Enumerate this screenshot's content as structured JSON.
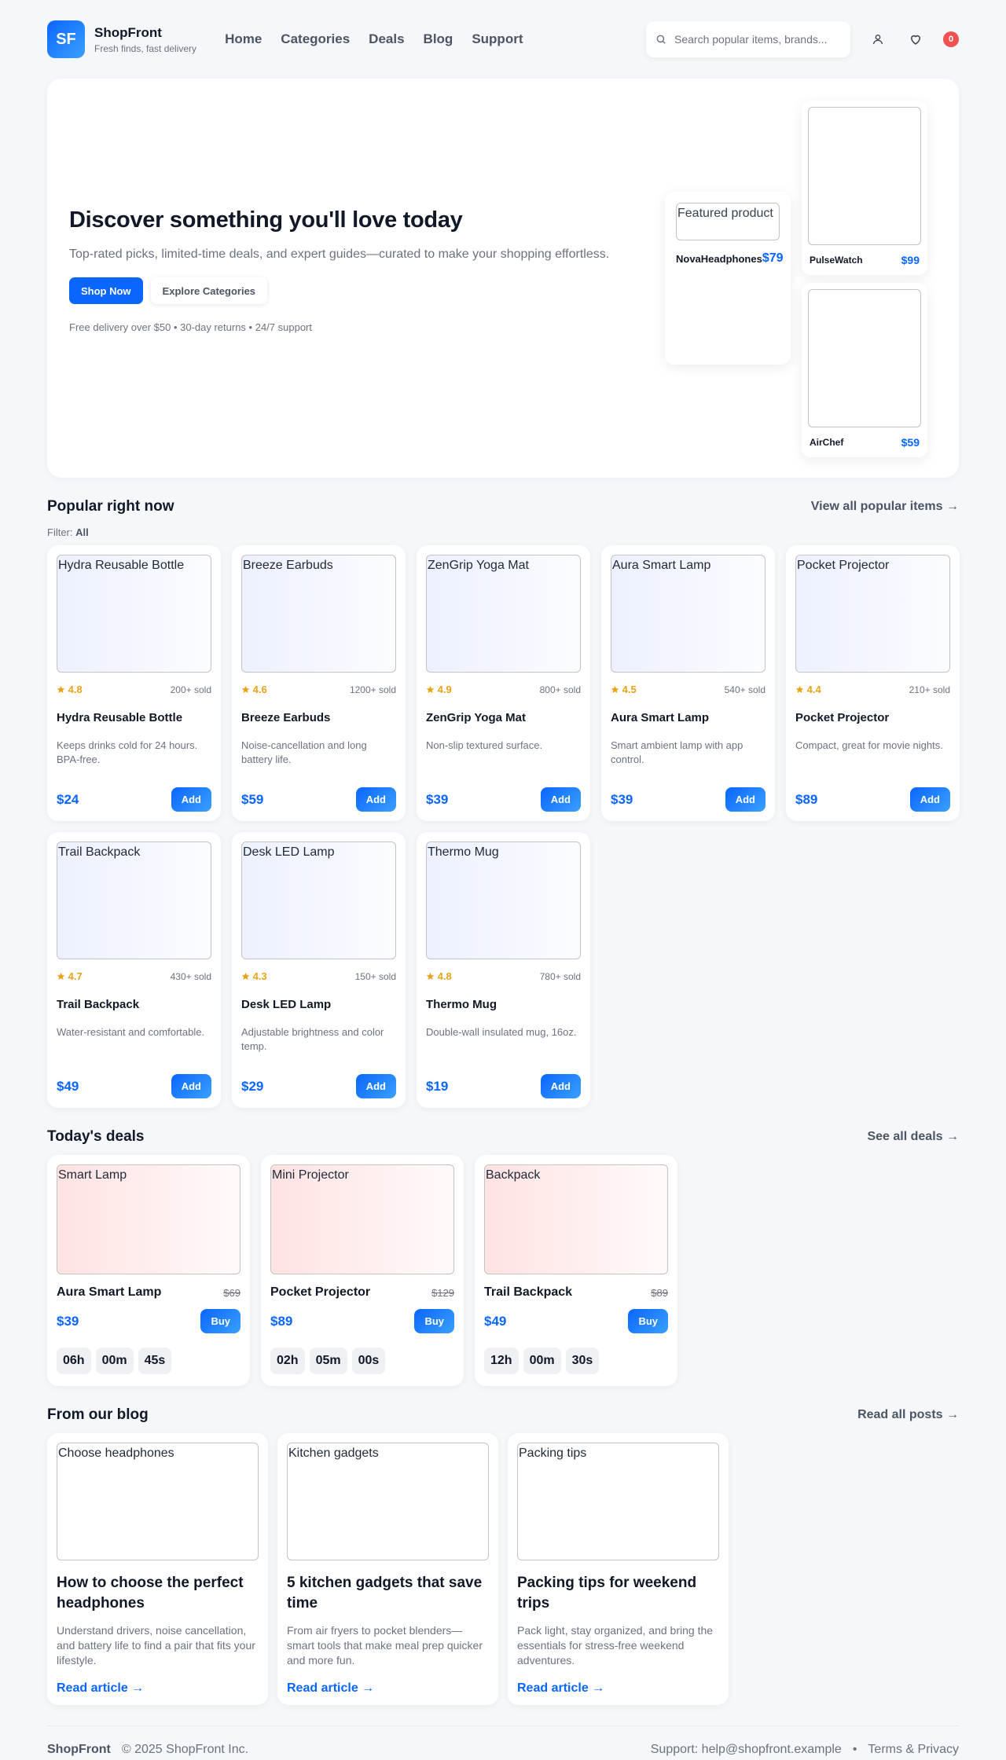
{
  "brand": {
    "initials": "SF",
    "name": "ShopFront",
    "tagline": "Fresh finds, fast delivery"
  },
  "nav": [
    "Home",
    "Categories",
    "Deals",
    "Blog",
    "Support"
  ],
  "search": {
    "placeholder": "Search popular items, brands..."
  },
  "cart": {
    "count": "0"
  },
  "hero": {
    "title": "Discover something you'll love today",
    "subtitle": "Top-rated picks, limited-time deals, and expert guides—curated to make your shopping effortless.",
    "primary_cta": "Shop Now",
    "secondary_cta": "Explore Categories",
    "note": "Free delivery over $50 • 30-day returns • 24/7 support",
    "featured": {
      "alt": "Featured product",
      "name": "NovaHeadphones",
      "price": "$79"
    },
    "side": [
      {
        "name": "PulseWatch",
        "price": "$99"
      },
      {
        "name": "AirChef",
        "price": "$59"
      }
    ]
  },
  "popular": {
    "title": "Popular right now",
    "link": "View all popular items →",
    "filter_label": "Filter:",
    "filter_value": "All",
    "add_label": "Add",
    "items": [
      {
        "name": "Hydra Reusable Bottle",
        "rating": "4.8",
        "sold": "200+ sold",
        "desc": "Keeps drinks cold for 24 hours. BPA-free.",
        "price": "$24"
      },
      {
        "name": "Breeze Earbuds",
        "rating": "4.6",
        "sold": "1200+ sold",
        "desc": "Noise-cancellation and long battery life.",
        "price": "$59"
      },
      {
        "name": "ZenGrip Yoga Mat",
        "rating": "4.9",
        "sold": "800+ sold",
        "desc": "Non-slip textured surface.",
        "price": "$39"
      },
      {
        "name": "Aura Smart Lamp",
        "rating": "4.5",
        "sold": "540+ sold",
        "desc": "Smart ambient lamp with app control.",
        "price": "$39"
      },
      {
        "name": "Pocket Projector",
        "rating": "4.4",
        "sold": "210+ sold",
        "desc": "Compact, great for movie nights.",
        "price": "$89"
      },
      {
        "name": "Trail Backpack",
        "rating": "4.7",
        "sold": "430+ sold",
        "desc": "Water-resistant and comfortable.",
        "price": "$49"
      },
      {
        "name": "Desk LED Lamp",
        "rating": "4.3",
        "sold": "150+ sold",
        "desc": "Adjustable brightness and color temp.",
        "price": "$29"
      },
      {
        "name": "Thermo Mug",
        "rating": "4.8",
        "sold": "780+ sold",
        "desc": "Double-wall insulated mug, 16oz.",
        "price": "$19"
      }
    ]
  },
  "deals": {
    "title": "Today's deals",
    "link": "See all deals →",
    "buy_label": "Buy",
    "items": [
      {
        "alt": "Smart Lamp",
        "name": "Aura Smart Lamp",
        "old_price": "$69",
        "price": "$39",
        "timer": [
          "06h",
          "00m",
          "45s"
        ]
      },
      {
        "alt": "Mini Projector",
        "name": "Pocket Projector",
        "old_price": "$129",
        "price": "$89",
        "timer": [
          "02h",
          "05m",
          "00s"
        ]
      },
      {
        "alt": "Backpack",
        "name": "Trail Backpack",
        "old_price": "$89",
        "price": "$49",
        "timer": [
          "12h",
          "00m",
          "30s"
        ]
      }
    ]
  },
  "blog": {
    "title": "From our blog",
    "link": "Read all posts →",
    "read_label": "Read article →",
    "posts": [
      {
        "alt": "Choose headphones",
        "title": "How to choose the perfect headphones",
        "desc": "Understand drivers, noise cancellation, and battery life to find a pair that fits your lifestyle."
      },
      {
        "alt": "Kitchen gadgets",
        "title": "5 kitchen gadgets that save time",
        "desc": "From air fryers to pocket blenders—smart tools that make meal prep quicker and more fun."
      },
      {
        "alt": "Packing tips",
        "title": "Packing tips for weekend trips",
        "desc": "Pack light, stay organized, and bring the essentials for stress-free weekend adventures."
      }
    ]
  },
  "footer": {
    "brand": "ShopFront",
    "copyright": "© 2025 ShopFront Inc.",
    "support": "Support: help@shopfront.example",
    "dot": "•",
    "terms": "Terms & Privacy"
  },
  "colors": {
    "accent": "#0a66ff",
    "rating": "#e8a317",
    "badge": "#f05252"
  },
  "icons": [
    "search-icon",
    "user-icon",
    "heart-icon",
    "star-icon"
  ]
}
